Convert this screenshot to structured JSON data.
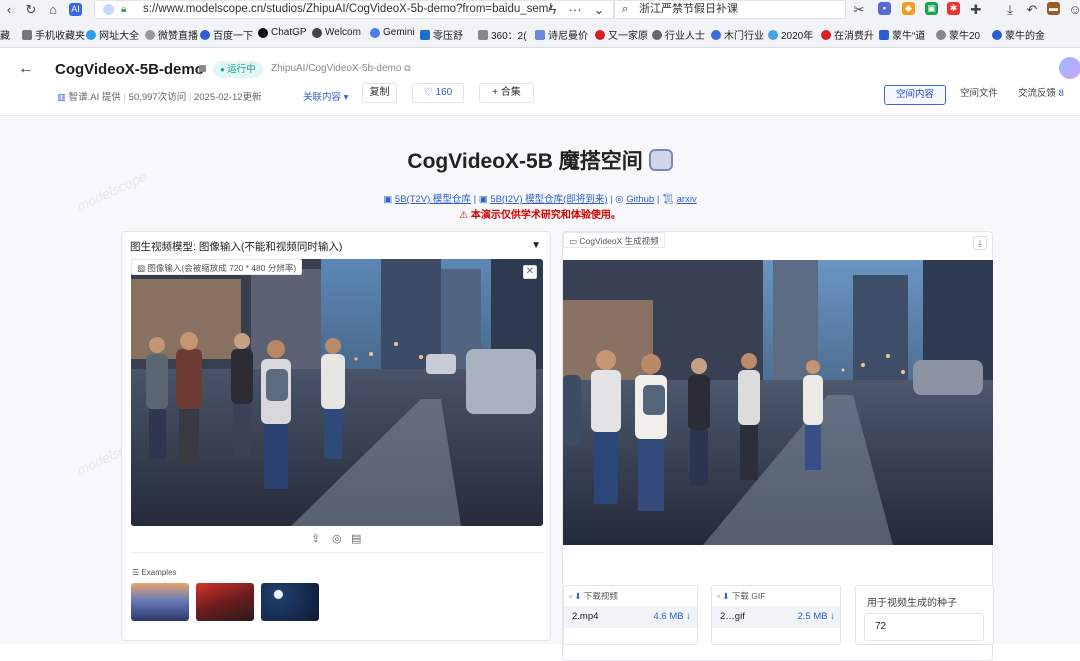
{
  "browser": {
    "url": "s://www.modelscope.cn/studios/ZhipuAI/CogVideoX-5b-demo?from=baidu_sem/",
    "search_text": "浙江严禁节假日补课",
    "bookmarks": [
      "手机收藏夹",
      "网址大全",
      "微赞直播",
      "百度一下",
      "ChatGP",
      "Welcom",
      "Gemini",
      "零压舒",
      "360：2(",
      "诗尼曼价",
      "又一家原",
      "行业人士",
      "木门行业",
      "2020年",
      "在消费升",
      "蒙牛“道",
      "蒙牛20",
      "蒙牛的金"
    ]
  },
  "header": {
    "title": "CogVideoX-5B-demo",
    "status": "运行中",
    "path": "ZhipuAI/CogVideoX-5b-demo",
    "provider": "智谱.AI",
    "provider_suffix": "提供",
    "visits": "50,997次访问",
    "updated": "2025-02-12更新",
    "related_label": "关联内容",
    "copy_label": "复制",
    "like_count": "160",
    "collect_label": "合集",
    "tabs": [
      "空间内容",
      "空间文件",
      "交流反馈"
    ],
    "tab_count": "8"
  },
  "hero": {
    "title": "CogVideoX-5B 魔搭空间",
    "links": [
      "5B(T2V) 模型仓库",
      "5B(I2V) 模型仓库(即将到来)",
      "Github",
      "arxiv"
    ],
    "warning": "本演示仅供学术研究和体验使用。"
  },
  "left_panel": {
    "model_label": "图生视频模型: 图像输入(不能和视频同时输入)",
    "image_input_label": "图像输入(会被缩放成 720 * 480 分辨率)",
    "examples_label": "Examples"
  },
  "right_panel": {
    "output_label": "CogVideoX 生成视频",
    "download_video_label": "下载视频",
    "download_video_file": "2.mp4",
    "download_video_size": "4.6 MB",
    "download_gif_label": "下载 GIF",
    "download_gif_file": "2…gif",
    "download_gif_size": "2.5 MB",
    "seed_label": "用于视频生成的种子",
    "seed_value": "72"
  },
  "watermark": "modelscope",
  "colors": {
    "accent": "#3b63e0",
    "running": "#18a08f",
    "warning": "#d40000"
  }
}
